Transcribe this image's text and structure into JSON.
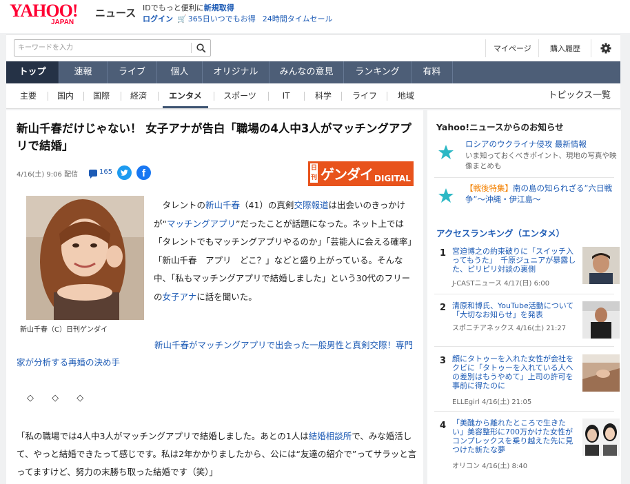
{
  "header": {
    "logo_text": "YAHOO!",
    "logo_sub": "JAPAN",
    "brand": "ニュース",
    "promo_prefix": "IDでもっと便利に",
    "promo_link": "新規取得",
    "login": "ログイン",
    "offer": "365日いつでもお得",
    "timesale": "24時間タイムセール"
  },
  "search": {
    "placeholder": "キーワードを入力"
  },
  "utility": {
    "mypage": "マイページ",
    "history": "購入履歴"
  },
  "primary_nav": [
    "トップ",
    "速報",
    "ライブ",
    "個人",
    "オリジナル",
    "みんなの意見",
    "ランキング",
    "有料"
  ],
  "secondary_nav": [
    "主要",
    "国内",
    "国際",
    "経済",
    "エンタメ",
    "スポーツ",
    "IT",
    "科学",
    "ライフ",
    "地域"
  ],
  "topics_link": "トピックス一覧",
  "article": {
    "title": "新山千春だけじゃない！ 女子アナが告白「職場の4人中3人がマッチングアプリで結婚」",
    "date": "4/16(土) 9:06 配信",
    "comments": "165",
    "publisher_logo": {
      "nikkan": "日刊",
      "main": "ゲンダイ",
      "digital": "DIGITAL"
    },
    "photo_caption": "新山千春（C）日刊ゲンダイ",
    "p1": [
      {
        "t": "　タレントの",
        "link": false
      },
      {
        "t": "新山千春",
        "link": true
      },
      {
        "t": "（41）の真剣",
        "link": false
      },
      {
        "t": "交際報道",
        "link": true
      },
      {
        "t": "は出会いのきっかけが“",
        "link": false
      },
      {
        "t": "マッチングアプリ",
        "link": true
      },
      {
        "t": "”だったことが話題になった。ネット上では「タレントでもマッチングアプリやるのか」「芸能人に会える確率」「新山千春　アプリ　どこ？」などと盛り上がっている。そんな中、「私もマッチングアプリで結婚しました」という30代のフリーの",
        "link": false
      },
      {
        "t": "女子アナ",
        "link": true
      },
      {
        "t": "に話を聞いた。",
        "link": false
      }
    ],
    "related": "新山千春がマッチングアプリで出会った一般男性と真剣交際！専門家が分析する再婚の決め手",
    "diamonds": "◇ ◇ ◇",
    "quote": [
      {
        "t": "「私の職場では4人中3人がマッチングアプリで結婚しました。あとの1人は",
        "link": false
      },
      {
        "t": "結婚相談所",
        "link": true
      },
      {
        "t": "で、みな婚活して、やっと結婚できたって感じです。私は2年かかりましたから、公には“友達の紹介で”ってサラッと言ってますけど、努力の末勝ち取った結婚です（笑）」",
        "link": false
      }
    ]
  },
  "sidebar": {
    "notice_heading": "Yahoo!ニュースからのお知らせ",
    "notices": [
      {
        "title": "ロシアのウクライナ侵攻 最新情報",
        "highlight": "",
        "sub": "いま知っておくべきポイント、現地の写真や映像まとめも"
      },
      {
        "title": "南の島の知られざる”六日戦争”～沖縄・伊江島～",
        "highlight": "【戦後特集】",
        "sub": ""
      }
    ],
    "ranking_heading": "アクセスランキング（エンタメ）",
    "ranking": [
      {
        "num": "1",
        "title": "宮迫博之の約束破りに「スイッチ入ってもうた」　千原ジュニアが暴露した、ピリピリ対談の裏側",
        "source": "J-CASTニュース 4/17(日) 6:00"
      },
      {
        "num": "2",
        "title": "清原和博氏、YouTube活動について「大切なお知らせ」を発表",
        "source": "スポニチアネックス 4/16(土) 21:27"
      },
      {
        "num": "3",
        "title": "顔にタトゥーを入れた女性が会社をクビに「タトゥーを入れている人への差別はもうやめて」上司の許可を事前に得たのに",
        "source": "ELLEgirl 4/16(土) 21:05"
      },
      {
        "num": "4",
        "title": "「美醜から離れたところで生きたい」美容整形に700万かけた女性がコンプレックスを乗り越えた先に見つけた新たな夢",
        "source": "オリコン 4/16(土) 8:40"
      }
    ]
  }
}
